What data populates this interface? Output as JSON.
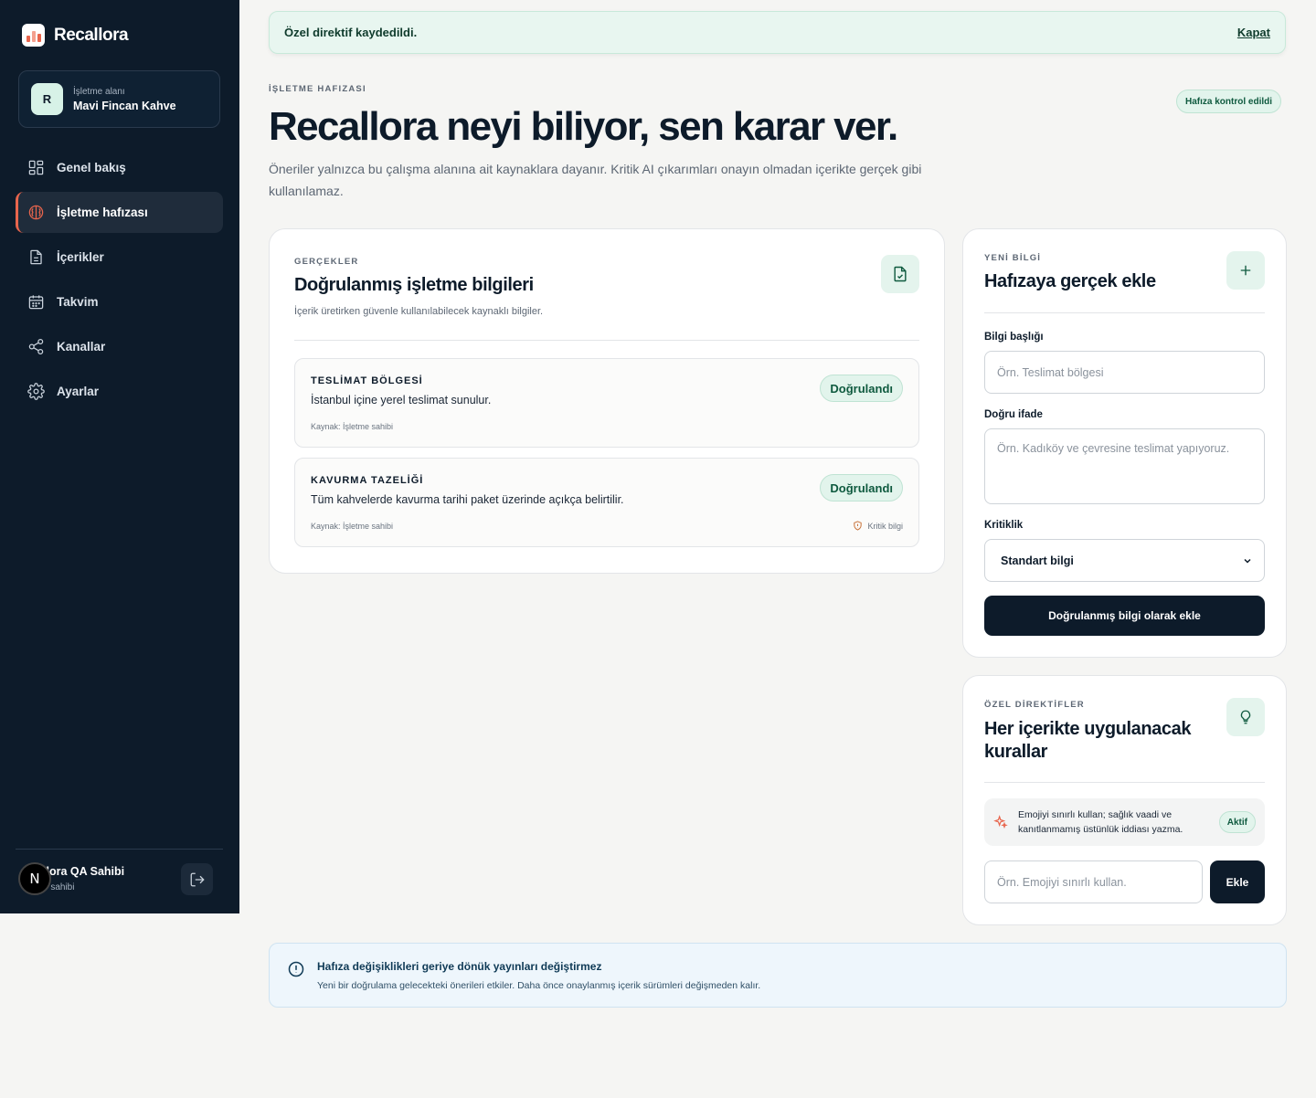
{
  "brand": {
    "name": "Recallora",
    "logo_colors": [
      "#e8654d",
      "#f4a08f",
      "#e8654d"
    ]
  },
  "workspace": {
    "avatar": "R",
    "label": "İşletme alanı",
    "name": "Mavi Fincan Kahve"
  },
  "nav": {
    "items": [
      {
        "label": "Genel bakış",
        "icon": "grid-icon"
      },
      {
        "label": "İşletme hafızası",
        "icon": "brain-icon",
        "active": true
      },
      {
        "label": "İçerikler",
        "icon": "document-icon"
      },
      {
        "label": "Takvim",
        "icon": "calendar-icon"
      },
      {
        "label": "Kanallar",
        "icon": "share-icon"
      },
      {
        "label": "Ayarlar",
        "icon": "gear-icon"
      }
    ]
  },
  "user": {
    "avatar": "N",
    "name": "llora QA Sahibi",
    "role": "p sahibi"
  },
  "toast": {
    "message": "Özel direktif kaydedildi.",
    "close_label": "Kapat"
  },
  "header": {
    "eyebrow": "İŞLETME HAFIZASI",
    "title": "Recallora neyi biliyor, sen karar ver.",
    "description": "Öneriler yalnızca bu çalışma alanına ait kaynaklara dayanır. Kritik AI çıkarımları onayın olmadan içerikte gerçek gibi kullanılamaz.",
    "badge": "Hafıza kontrol edildi"
  },
  "facts": {
    "eyebrow": "GERÇEKLER",
    "title": "Doğrulanmış işletme bilgileri",
    "subtitle": "İçerik üretirken güvenle kullanılabilecek kaynaklı bilgiler.",
    "items": [
      {
        "label": "TESLİMAT BÖLGESİ",
        "text": "İstanbul içine yerel teslimat sunulur.",
        "source": "Kaynak: İşletme sahibi",
        "status": "Doğrulandı",
        "critical": ""
      },
      {
        "label": "KAVURMA TAZELİĞİ",
        "text": "Tüm kahvelerde kavurma tarihi paket üzerinde açıkça belirtilir.",
        "source": "Kaynak: İşletme sahibi",
        "status": "Doğrulandı",
        "critical": "Kritik bilgi"
      }
    ]
  },
  "add_fact": {
    "eyebrow": "YENİ BİLGİ",
    "title": "Hafızaya gerçek ekle",
    "title_label": "Bilgi başlığı",
    "title_placeholder": "Örn. Teslimat bölgesi",
    "statement_label": "Doğru ifade",
    "statement_placeholder": "Örn. Kadıköy ve çevresine teslimat yapıyoruz.",
    "criticality_label": "Kritiklik",
    "criticality_value": "Standart bilgi",
    "submit_label": "Doğrulanmış bilgi olarak ekle"
  },
  "directives": {
    "eyebrow": "ÖZEL DİREKTİFLER",
    "title": "Her içerikte uygulanacak kurallar",
    "items": [
      {
        "text": "Emojiyi sınırlı kullan; sağlık vaadi ve kanıtlanmamış üstünlük iddiası yazma.",
        "status": "Aktif"
      }
    ],
    "input_placeholder": "Örn. Emojiyi sınırlı kullan.",
    "add_label": "Ekle"
  },
  "info": {
    "title": "Hafıza değişiklikleri geriye dönük yayınları değiştirmez",
    "text": "Yeni bir doğrulama gelecekteki önerileri etkiler. Daha önce onaylanmış içerik sürümleri değişmeden kalır."
  }
}
